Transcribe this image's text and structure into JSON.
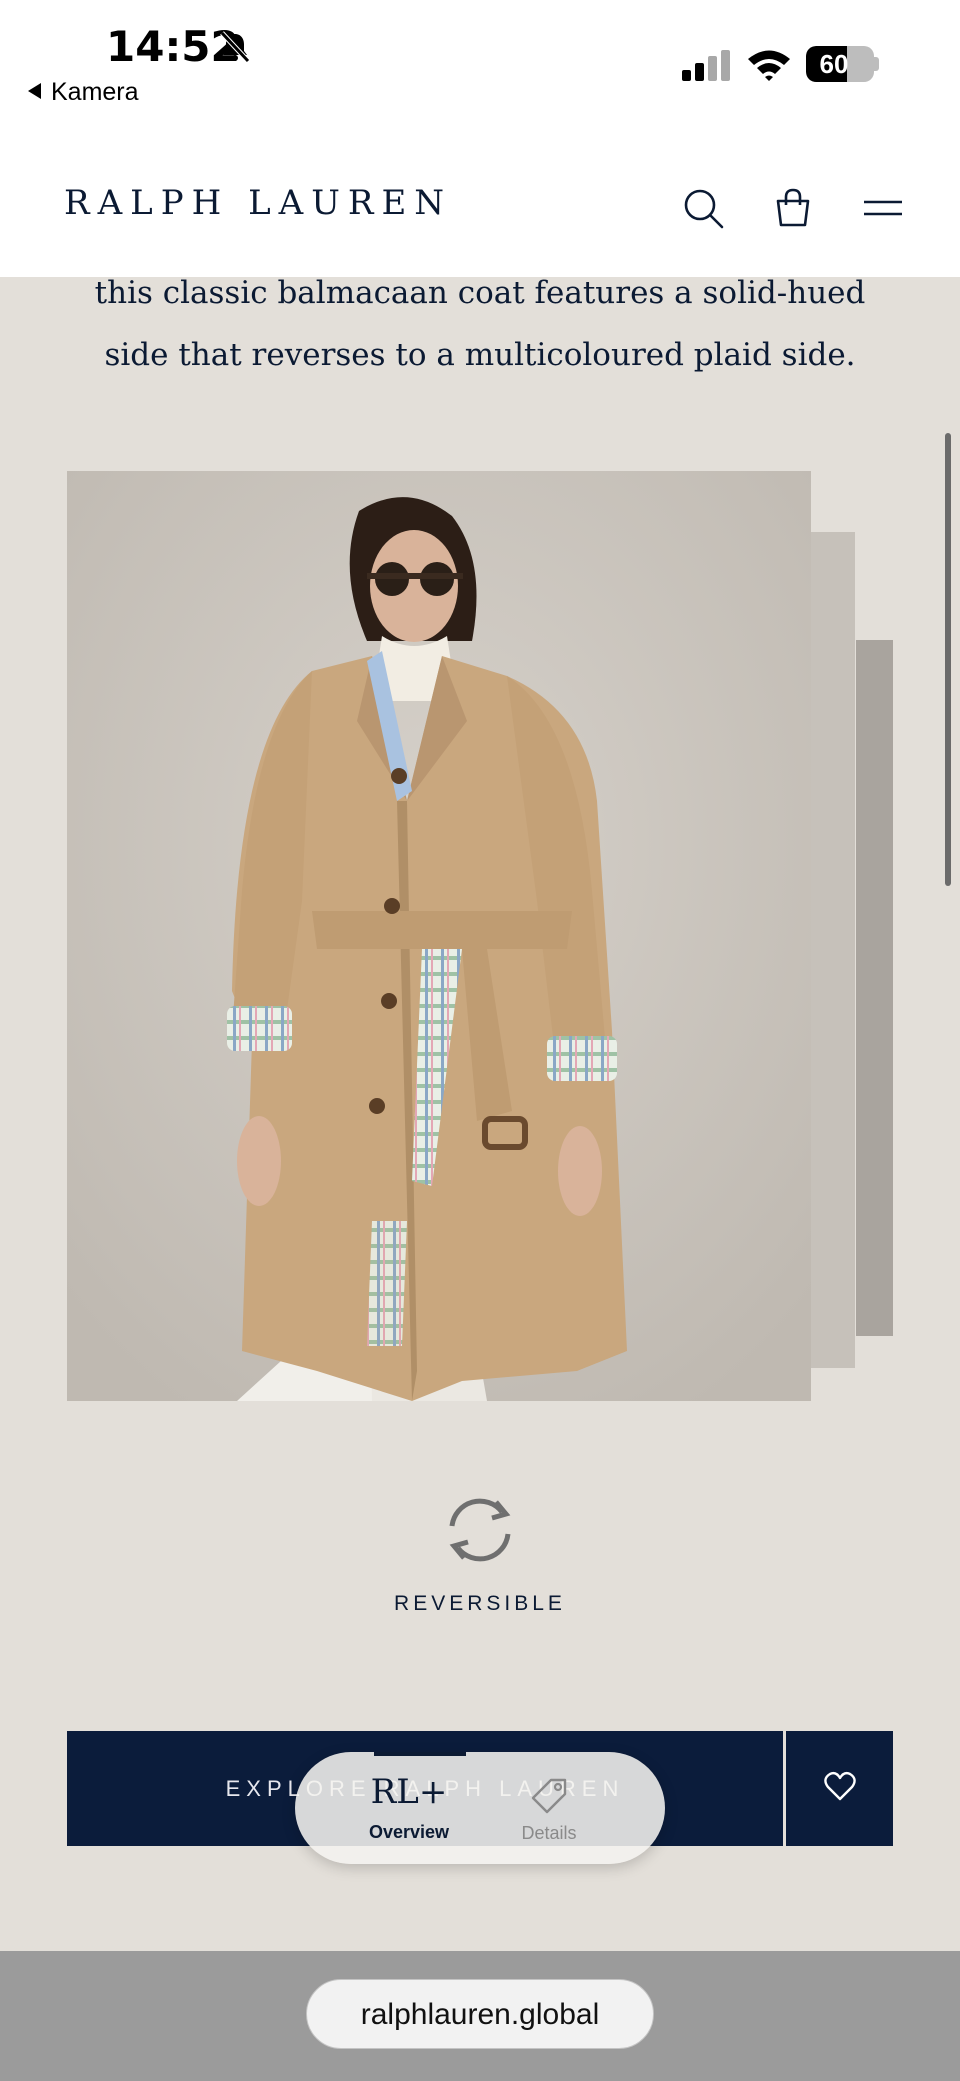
{
  "status_bar": {
    "time": "14:52",
    "back_label": "Kamera",
    "battery_percent": "60",
    "battery_level": 0.6
  },
  "header": {
    "logo": "RALPH LAUREN"
  },
  "content": {
    "description_line1": "this classic balmacaan coat features a solid-hued",
    "description_line2": "side that reverses to a multicoloured plaid side.",
    "feature_label": "REVERSIBLE",
    "explore_button": "EXPLORE RALPH LAUREN"
  },
  "bottom_tabs": [
    {
      "label": "Overview",
      "icon": "rl-plus-logo",
      "glyph": "RL+",
      "active": true
    },
    {
      "label": "Details",
      "icon": "tag-icon",
      "active": false
    }
  ],
  "browser": {
    "url": "ralphlauren.global"
  },
  "colors": {
    "navy": "#0b1c3b",
    "background": "#e3dfd9",
    "coat": "#c9a77e"
  }
}
